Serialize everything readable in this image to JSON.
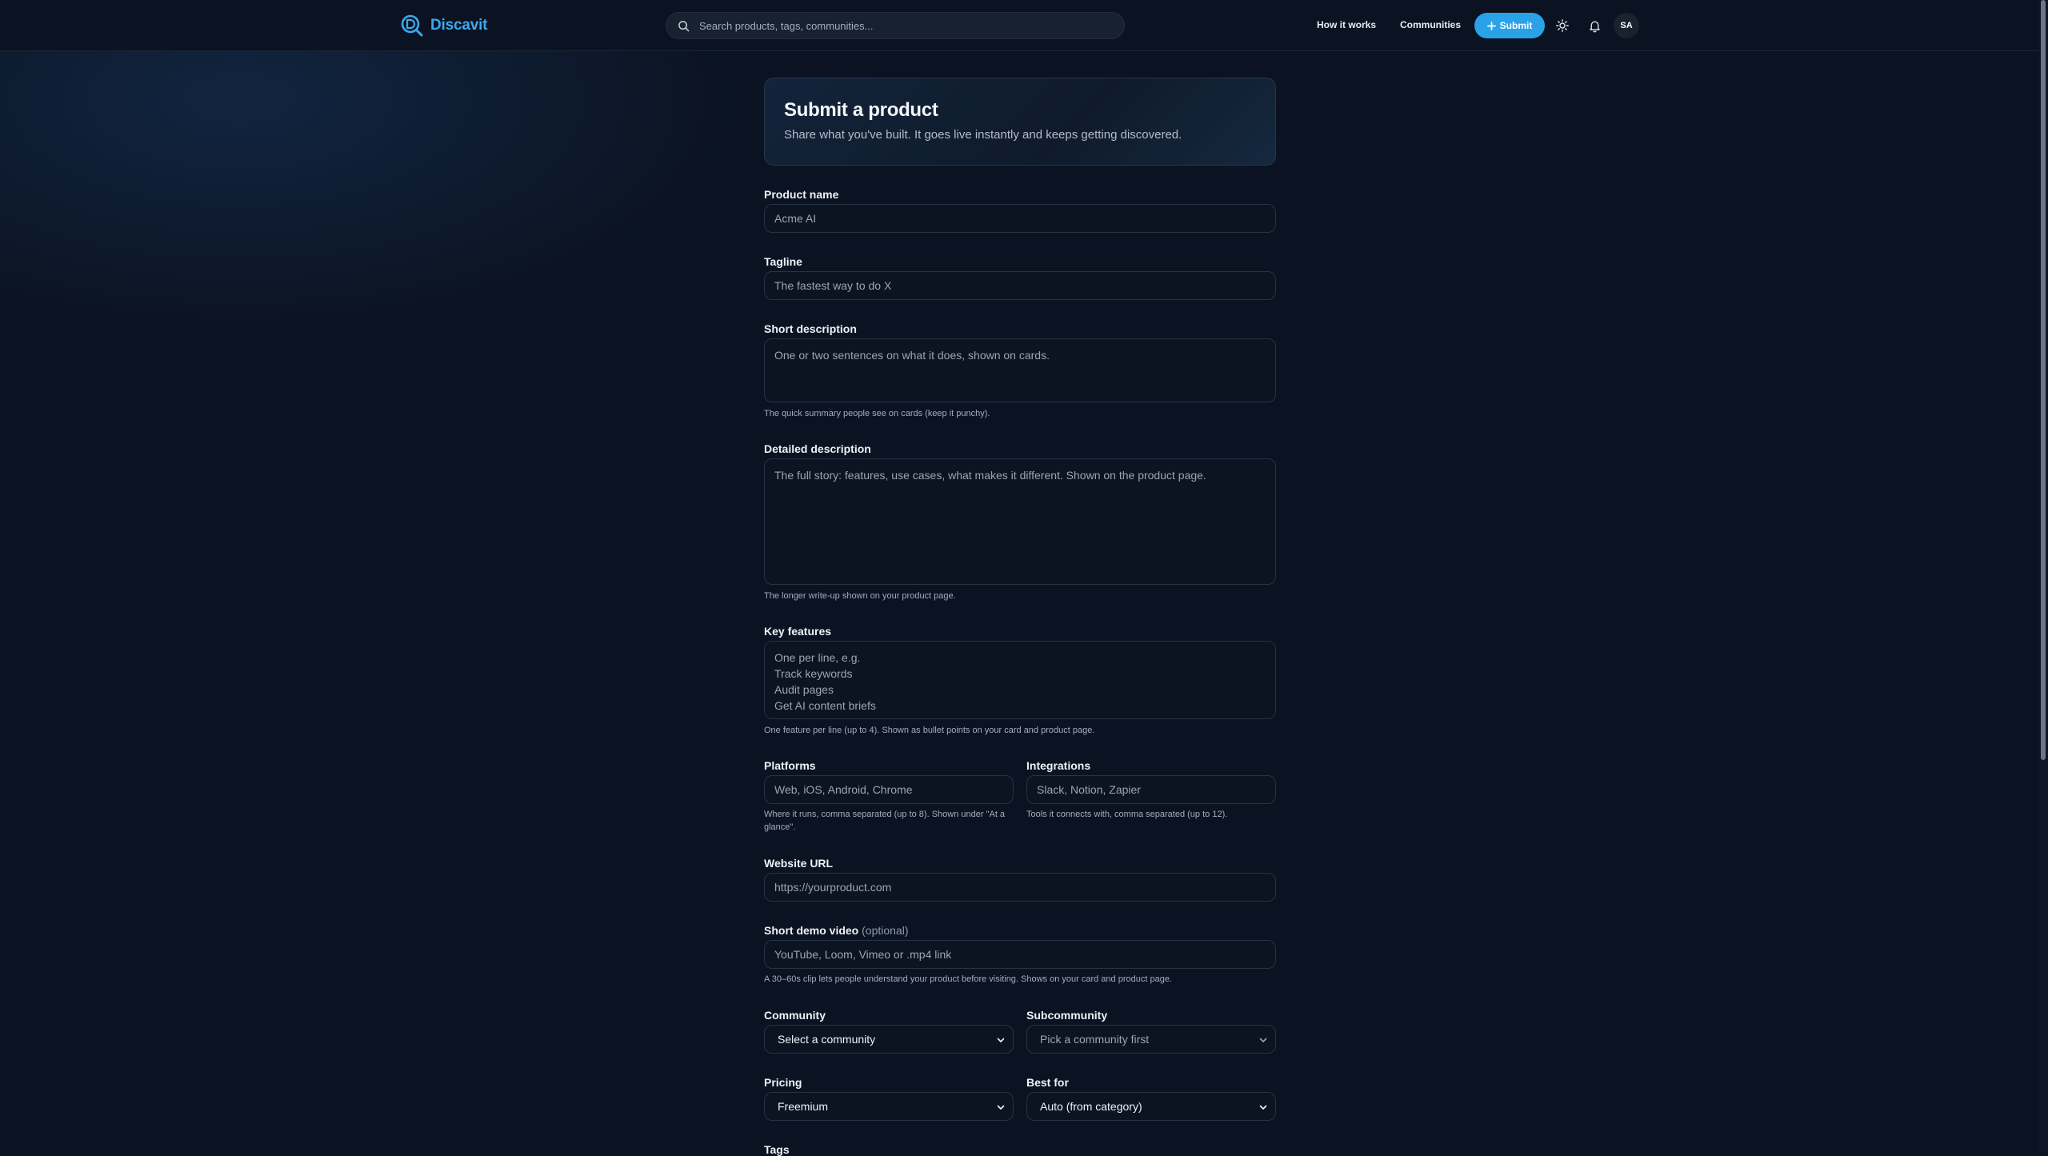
{
  "brand": {
    "name": "Discavit",
    "accent": "#3ba9ee"
  },
  "search": {
    "placeholder": "Search products, tags, communities..."
  },
  "nav": {
    "how_it_works": "How it works",
    "communities": "Communities",
    "submit": "Submit",
    "avatar_initials": "SA"
  },
  "hero": {
    "title": "Submit a product",
    "subtitle": "Share what you've built. It goes live instantly and keeps getting discovered."
  },
  "form": {
    "product_name": {
      "label": "Product name",
      "placeholder": "Acme AI"
    },
    "tagline": {
      "label": "Tagline",
      "placeholder": "The fastest way to do X"
    },
    "short_description": {
      "label": "Short description",
      "placeholder": "One or two sentences on what it does, shown on cards.",
      "help": "The quick summary people see on cards (keep it punchy)."
    },
    "detailed_description": {
      "label": "Detailed description",
      "placeholder": "The full story: features, use cases, what makes it different. Shown on the product page.",
      "help": "The longer write-up shown on your product page."
    },
    "key_features": {
      "label": "Key features",
      "placeholder": "One per line, e.g.\nTrack keywords\nAudit pages\nGet AI content briefs",
      "help": "One feature per line (up to 4). Shown as bullet points on your card and product page."
    },
    "platforms": {
      "label": "Platforms",
      "placeholder": "Web, iOS, Android, Chrome",
      "help": "Where it runs, comma separated (up to 8). Shown under \"At a glance\"."
    },
    "integrations": {
      "label": "Integrations",
      "placeholder": "Slack, Notion, Zapier",
      "help": "Tools it connects with, comma separated (up to 12)."
    },
    "website_url": {
      "label": "Website URL",
      "placeholder": "https://yourproduct.com"
    },
    "demo_video": {
      "label": "Short demo video",
      "optional": "(optional)",
      "placeholder": "YouTube, Loom, Vimeo or .mp4 link",
      "help": "A 30–60s clip lets people understand your product before visiting. Shows on your card and product page."
    },
    "community": {
      "label": "Community",
      "value": "Select a community"
    },
    "subcommunity": {
      "label": "Subcommunity",
      "value": "Pick a community first"
    },
    "pricing": {
      "label": "Pricing",
      "value": "Freemium"
    },
    "best_for": {
      "label": "Best for",
      "value": "Auto (from category)"
    },
    "tags": {
      "label": "Tags"
    }
  }
}
